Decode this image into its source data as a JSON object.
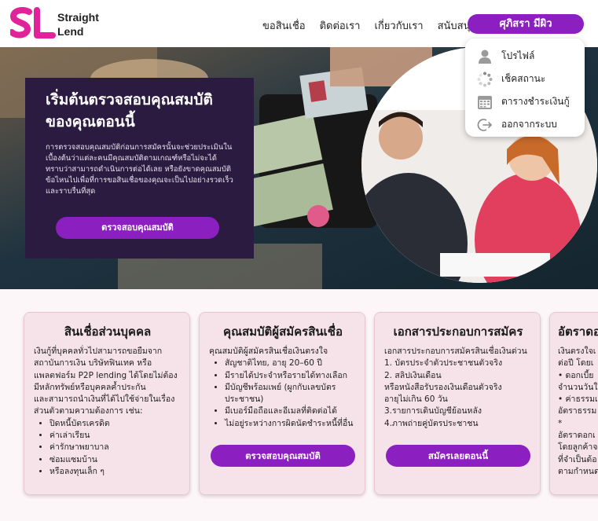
{
  "brand": {
    "name_line1": "Straight",
    "name_line2": "Lend",
    "accent": "#8b1fc0",
    "logo_color": "#e0239a"
  },
  "nav": {
    "items": [
      "ขอสินเชื่อ",
      "ติดต่อเรา",
      "เกี่ยวกับเรา",
      "สนับสนุน"
    ],
    "user_label": "ศุภิสรา มีผิว"
  },
  "dropdown": {
    "items": [
      {
        "label": "โปรไฟล์",
        "icon": "user-icon"
      },
      {
        "label": "เช็คสถานะ",
        "icon": "loading-icon"
      },
      {
        "label": "ตารางชำระเงินกู้",
        "icon": "calendar-icon"
      },
      {
        "label": "ออกจากระบบ",
        "icon": "logout-icon"
      }
    ]
  },
  "hero": {
    "title_line1": "เริ่มต้นตรวจสอบคุณสมบัติ",
    "title_line2": "ของคุณตอนนี้",
    "desc": "การตรวจสอบคุณสมบัติก่อนการสมัครนั้นจะช่วยประเมินในเบื้องต้นว่าแต่ละคนมีคุณสมบัติตามเกณฑ์หรือไม่จะได้ทราบว่าสามารถดำเนินการต่อได้เลย หรือยังขาดคุณสมบัติข้อไหนไปเพื่อที่การขอสินเชื่อของคุณจะเป็นไปอย่างรวดเร็วและราบรื่นที่สุด",
    "button": "ตรวจสอบคุณสมบัติ"
  },
  "cards": [
    {
      "title": "สินเชื่อส่วนบุคคล",
      "lines": [
        "เงินกู้ที่บุคคลทั่วไปสามารถขอยืมจากสถาบันการเงิน บริษัทฟินเทค หรือแพลตฟอร์ม P2P lending ได้โดยไม่ต้องมีหลักทรัพย์หรือบุคคลค้ำประกัน",
        "และสามารถนำเงินที่ได้ไปใช้จ่ายในเรื่องส่วนตัวตามความต้องการ เช่น:"
      ],
      "bullets": [
        "ปิดหนี้บัตรเครดิต",
        "ค่าเล่าเรียน",
        "ค่ารักษาพยาบาล",
        "ซ่อมแซมบ้าน",
        "หรือลงทุนเล็ก ๆ"
      ]
    },
    {
      "title": "คุณสมบัติผู้สมัครสินเชื่อ",
      "lines": [
        "คุณสมบัติผู้สมัครสินเชื่อเงินตรงใจ"
      ],
      "bullets": [
        "สัญชาติไทย, อายุ 20–60 ปี",
        "มีรายได้ประจำหรือรายได้ทางเลือก",
        "มีบัญชีพร้อมเพย์ (ผูกกับเลขบัตรประชาชน)",
        "มีเบอร์มือถือและอีเมลที่ติดต่อได้",
        "ไม่อยู่ระหว่างการผิดนัดชำระหนี้ที่อื่น"
      ],
      "button": "ตรวจสอบคุณสมบัติ"
    },
    {
      "title": "เอกสารประกอบการสมัคร",
      "lines": [
        "เอกสารประกอบการสมัครสินเชื่อเงินด่วน",
        "1. บัตรประจำตัวประชาชนตัวจริง",
        "2. สลิปเงินเดือน",
        "หรือหนังสือรับรองเงินเดือนตัวจริง",
        "อายุไม่เกิน 60 วัน",
        "3.รายการเดินบัญชีย้อนหลัง",
        "4.ภาพถ่ายคู่บัตรประชาชน"
      ],
      "button": "สมัครเลยตอนนี้"
    },
    {
      "title": "อัตราดอ",
      "lines": [
        "เงินตรงใจเ",
        "ต่อปี โดยเ",
        "• ดอกเบี้ย",
        "จำนวนวันใ",
        "• ค่าธรรมเ",
        "อัตราธรรม",
        "*",
        "อัตราดอกเ",
        "โดยลูกค้าจ",
        "ที่จำเป็นต้อ",
        "ตามกำหนด"
      ]
    }
  ]
}
